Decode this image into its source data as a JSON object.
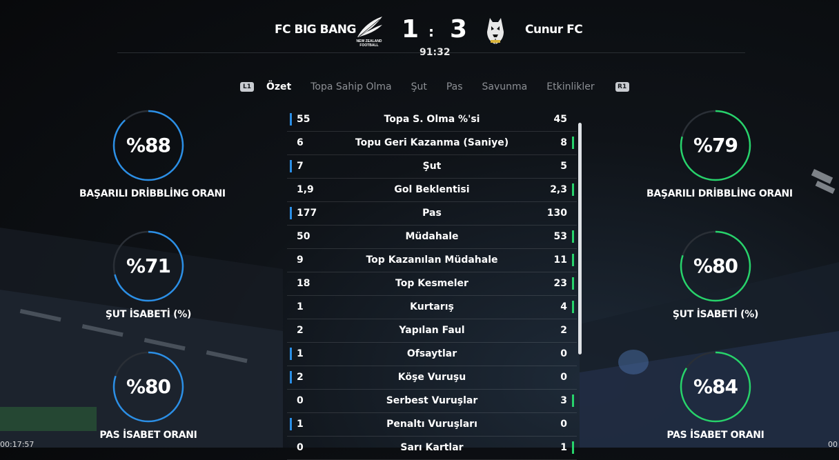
{
  "match": {
    "home_team": "FC BIG BANG",
    "away_team": "Cunur FC",
    "home_score": "1",
    "away_score": "3",
    "separator": ":",
    "clock": "91:32",
    "home_crest_text": "NEW ZEALAND FOOTBALL"
  },
  "tabs": {
    "left_button": "L1",
    "right_button": "R1",
    "items": [
      "Özet",
      "Topa Sahip Olma",
      "Şut",
      "Pas",
      "Savunma",
      "Etkinlikler"
    ]
  },
  "home_rings": [
    {
      "value": "%88",
      "label": "BAŞARILI DRİBBLİNG ORANI",
      "percent": 88
    },
    {
      "value": "%71",
      "label": "ŞUT İSABETİ (%)",
      "percent": 71
    },
    {
      "value": "%80",
      "label": "PAS İSABET ORANI",
      "percent": 80
    }
  ],
  "away_rings": [
    {
      "value": "%79",
      "label": "BAŞARILI DRİBBLİNG ORANI",
      "percent": 79
    },
    {
      "value": "%80",
      "label": "ŞUT İSABETİ (%)",
      "percent": 80
    },
    {
      "value": "%84",
      "label": "PAS İSABET ORANI",
      "percent": 84
    }
  ],
  "stats": [
    {
      "name": "Topa S. Olma %'si",
      "home": "55",
      "away": "45",
      "leader": "home"
    },
    {
      "name": "Topu Geri Kazanma (Saniye)",
      "home": "6",
      "away": "8",
      "leader": "away"
    },
    {
      "name": "Şut",
      "home": "7",
      "away": "5",
      "leader": "home"
    },
    {
      "name": "Gol Beklentisi",
      "home": "1,9",
      "away": "2,3",
      "leader": "away"
    },
    {
      "name": "Pas",
      "home": "177",
      "away": "130",
      "leader": "home"
    },
    {
      "name": "Müdahale",
      "home": "50",
      "away": "53",
      "leader": "away"
    },
    {
      "name": "Top Kazanılan Müdahale",
      "home": "9",
      "away": "11",
      "leader": "away"
    },
    {
      "name": "Top Kesmeler",
      "home": "18",
      "away": "23",
      "leader": "away"
    },
    {
      "name": "Kurtarış",
      "home": "1",
      "away": "4",
      "leader": "away"
    },
    {
      "name": "Yapılan Faul",
      "home": "2",
      "away": "2",
      "leader": "none"
    },
    {
      "name": "Ofsaytlar",
      "home": "1",
      "away": "0",
      "leader": "home"
    },
    {
      "name": "Köşe Vuruşu",
      "home": "2",
      "away": "0",
      "leader": "home"
    },
    {
      "name": "Serbest Vuruşlar",
      "home": "0",
      "away": "3",
      "leader": "away"
    },
    {
      "name": "Penaltı Vuruşları",
      "home": "1",
      "away": "0",
      "leader": "home"
    },
    {
      "name": "Sarı Kartlar",
      "home": "0",
      "away": "1",
      "leader": "away"
    }
  ],
  "colors": {
    "home": "#2b8fe6",
    "away": "#27d36b",
    "ring_track": "#2a2f36"
  },
  "timestamps": {
    "left": "00:17:57",
    "right": "00"
  }
}
